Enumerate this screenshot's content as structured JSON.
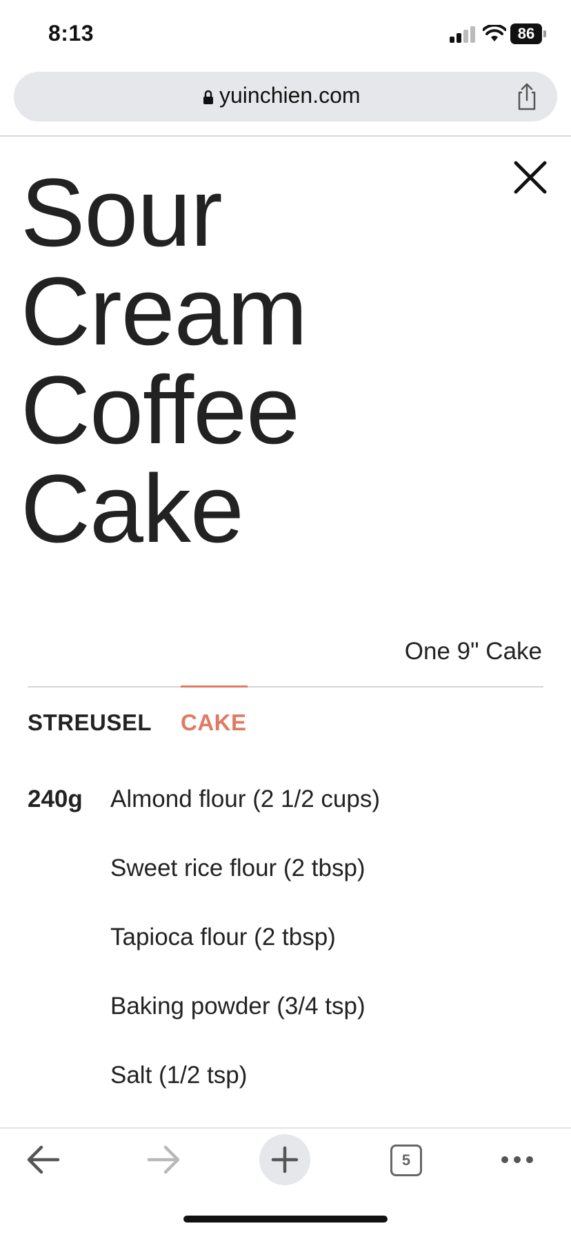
{
  "status_bar": {
    "time": "8:13",
    "battery": "86"
  },
  "browser": {
    "url": "yuinchien.com",
    "tab_count": "5"
  },
  "recipe": {
    "title_lines": [
      "Sour",
      "Cream",
      "Coffee",
      "Cake"
    ],
    "yield": "One 9\" Cake",
    "tabs": [
      {
        "label": "STREUSEL",
        "active": false
      },
      {
        "label": "CAKE",
        "active": true
      }
    ],
    "ingredients": [
      {
        "qty": "240g",
        "name": "Almond flour (2 1/2 cups)"
      },
      {
        "qty": "",
        "name": "Sweet rice flour (2 tbsp)"
      },
      {
        "qty": "",
        "name": "Tapioca flour (2 tbsp)"
      },
      {
        "qty": "",
        "name": "Baking powder (3/4 tsp)"
      },
      {
        "qty": "",
        "name": "Salt (1/2 tsp)"
      }
    ]
  },
  "colors": {
    "accent": "#e07a62",
    "text": "#222222",
    "url_bar": "#e6e7ea"
  },
  "icons": {
    "close": "close-icon",
    "share": "share-icon",
    "lock": "lock-icon",
    "back": "back-arrow-icon",
    "forward": "forward-arrow-icon",
    "new_tab": "plus-icon",
    "tabs": "tabs-icon",
    "more": "more-icon"
  }
}
